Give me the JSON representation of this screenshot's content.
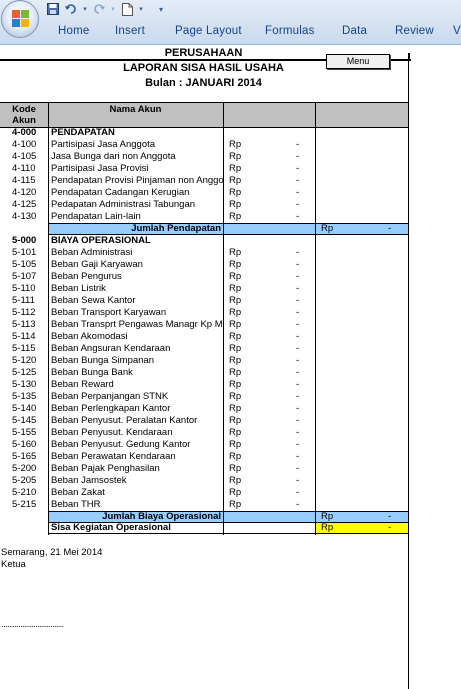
{
  "ribbon": {
    "tabs": [
      "Home",
      "Insert",
      "Page Layout",
      "Formulas",
      "Data",
      "Review",
      "V"
    ]
  },
  "report": {
    "company": "PERUSAHAAN",
    "title": "LAPORAN SISA HASIL USAHA",
    "period": "Bulan : JANUARI 2014",
    "menu_button": "Menu"
  },
  "table": {
    "col_code": "Kode Akun",
    "col_code_line1": "Kode",
    "col_code_line2": "Akun",
    "col_name": "Nama Akun",
    "currency": "Rp",
    "empty_value": "-",
    "income_header": {
      "code": "4-000",
      "name": "PENDAPATAN"
    },
    "income_rows": [
      {
        "code": "4-100",
        "name": "Partisipasi Jasa Anggota"
      },
      {
        "code": "4-105",
        "name": "Jasa Bunga dari non Anggota"
      },
      {
        "code": "4-110",
        "name": "Partisipasi Jasa Provisi"
      },
      {
        "code": "4-115",
        "name": "Pendapatan Provisi Pinjaman non Anggota"
      },
      {
        "code": "4-120",
        "name": "Pendapatan Cadangan Kerugian"
      },
      {
        "code": "4-125",
        "name": "Pedapatan Administrasi Tabungan"
      },
      {
        "code": "4-130",
        "name": "Pendapatan Lain-lain"
      }
    ],
    "income_total": "Jumlah Pendapatan",
    "expense_header": {
      "code": "5-000",
      "name": "BIAYA OPERASIONAL"
    },
    "expense_rows": [
      {
        "code": "5-101",
        "name": "Beban Administrasi"
      },
      {
        "code": "5-105",
        "name": "Beban Gaji Karyawan"
      },
      {
        "code": "5-107",
        "name": "Beban Pengurus"
      },
      {
        "code": "5-110",
        "name": "Beban Listrik"
      },
      {
        "code": "5-111",
        "name": "Beban Sewa Kantor"
      },
      {
        "code": "5-112",
        "name": "Beban Transport Karyawan"
      },
      {
        "code": "5-113",
        "name": "Beban Transprt Pengawas Managr Kp Manager"
      },
      {
        "code": "5-114",
        "name": "Beban Akomodasi"
      },
      {
        "code": "5-115",
        "name": "Beban Angsuran Kendaraan"
      },
      {
        "code": "5-120",
        "name": "Beban Bunga Simpanan"
      },
      {
        "code": "5-125",
        "name": "Beban Bunga Bank"
      },
      {
        "code": "5-130",
        "name": "Beban Reward"
      },
      {
        "code": "5-135",
        "name": "Beban Perpanjangan STNK"
      },
      {
        "code": "5-140",
        "name": "Beban Perlengkapan Kantor"
      },
      {
        "code": "5-145",
        "name": "Beban Penyusut. Peralatan Kantor"
      },
      {
        "code": "5-155",
        "name": "Beban Penyusut. Kendaraan"
      },
      {
        "code": "5-160",
        "name": "Beban Penyusut. Gedung Kantor"
      },
      {
        "code": "5-165",
        "name": "Beban Perawatan Kendaraan"
      },
      {
        "code": "5-200",
        "name": "Beban Pajak Penghasilan"
      },
      {
        "code": "5-205",
        "name": "Beban Jamsostek"
      },
      {
        "code": "5-210",
        "name": "Beban Zakat"
      },
      {
        "code": "5-215",
        "name": "Beban THR"
      }
    ],
    "expense_total": "Jumlah Biaya Operasional",
    "net_total": "Sisa Kegiatan Operasional"
  },
  "footer": {
    "place_date": "Semarang,  21 Mei 2014",
    "signer_role": "Ketua",
    "signature_line": "............................."
  },
  "colors": {
    "total_fill": "#99ccff",
    "net_highlight": "#ffff00",
    "header_fill": "#c0c0c0"
  }
}
